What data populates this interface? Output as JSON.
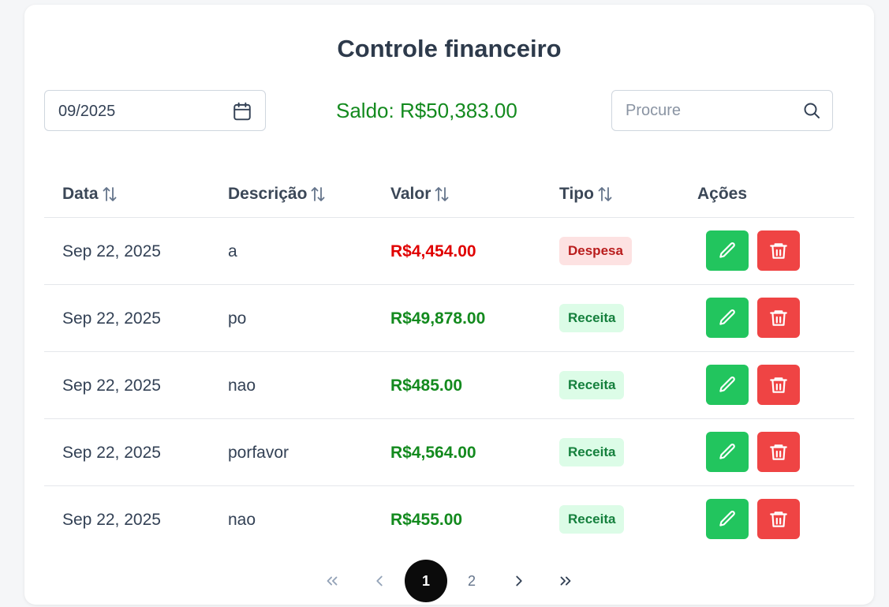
{
  "title": "Controle financeiro",
  "month_filter": {
    "value": "09/2025",
    "icon": "calendar-icon"
  },
  "saldo": "Saldo: R$50,383.00",
  "search": {
    "placeholder": "Procure",
    "icon": "search-icon"
  },
  "table": {
    "headers": [
      "Data",
      "Descrição",
      "Valor",
      "Tipo",
      "Ações"
    ],
    "rows": [
      {
        "date": "Sep 22, 2025",
        "description": "a",
        "value": "R$4,454.00",
        "type": "Despesa"
      },
      {
        "date": "Sep 22, 2025",
        "description": "po",
        "value": "R$49,878.00",
        "type": "Receita"
      },
      {
        "date": "Sep 22, 2025",
        "description": "nao",
        "value": "R$485.00",
        "type": "Receita"
      },
      {
        "date": "Sep 22, 2025",
        "description": "porfavor",
        "value": "R$4,564.00",
        "type": "Receita"
      },
      {
        "date": "Sep 22, 2025",
        "description": "nao",
        "value": "R$455.00",
        "type": "Receita"
      }
    ]
  },
  "pagination": {
    "pages": [
      "1",
      "2"
    ],
    "current": "1"
  },
  "colors": {
    "saldo": "#138a1e",
    "despesa_value": "#e00000",
    "receita_value": "#138a1e",
    "edit_button": "#22c55e",
    "delete_button": "#ef4444"
  }
}
